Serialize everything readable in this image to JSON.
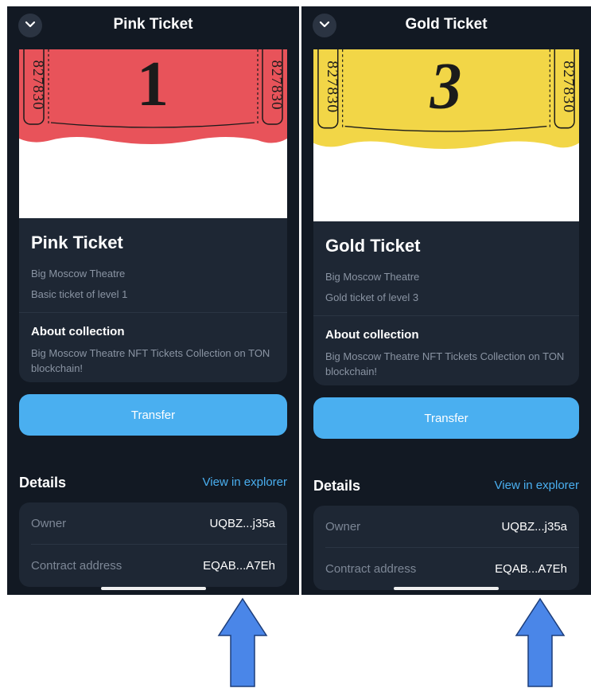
{
  "screens": [
    {
      "header_title": "Pink Ticket",
      "ticket_number": "1",
      "ticket_serial": "827830",
      "ticket_color": "#e8535a",
      "name": "Pink Ticket",
      "collection": "Big Moscow Theatre",
      "description": "Basic ticket of level 1",
      "about_heading": "About collection",
      "about_text": "Big Moscow Theatre NFT Tickets Collection on TON blockchain!",
      "transfer_label": "Transfer",
      "details_heading": "Details",
      "explorer_link": "View in explorer",
      "owner_label": "Owner",
      "owner_value": "UQBZ...j35a",
      "contract_label": "Contract address",
      "contract_value": "EQAB...A7Eh"
    },
    {
      "header_title": "Gold Ticket",
      "ticket_number": "3",
      "ticket_serial": "827830",
      "ticket_color": "#f2d647",
      "name": "Gold Ticket",
      "collection": "Big Moscow Theatre",
      "description": "Gold ticket of level 3",
      "about_heading": "About collection",
      "about_text": "Big Moscow Theatre NFT Tickets Collection on TON blockchain!",
      "transfer_label": "Transfer",
      "details_heading": "Details",
      "explorer_link": "View in explorer",
      "owner_label": "Owner",
      "owner_value": "UQBZ...j35a",
      "contract_label": "Contract address",
      "contract_value": "EQAB...A7Eh"
    }
  ],
  "colors": {
    "background": "#121923",
    "card": "#1e2734",
    "accent": "#4aaff0",
    "arrow": "#4a86e8"
  },
  "icons": [
    "chevron-down-icon",
    "up-arrow-icon"
  ]
}
